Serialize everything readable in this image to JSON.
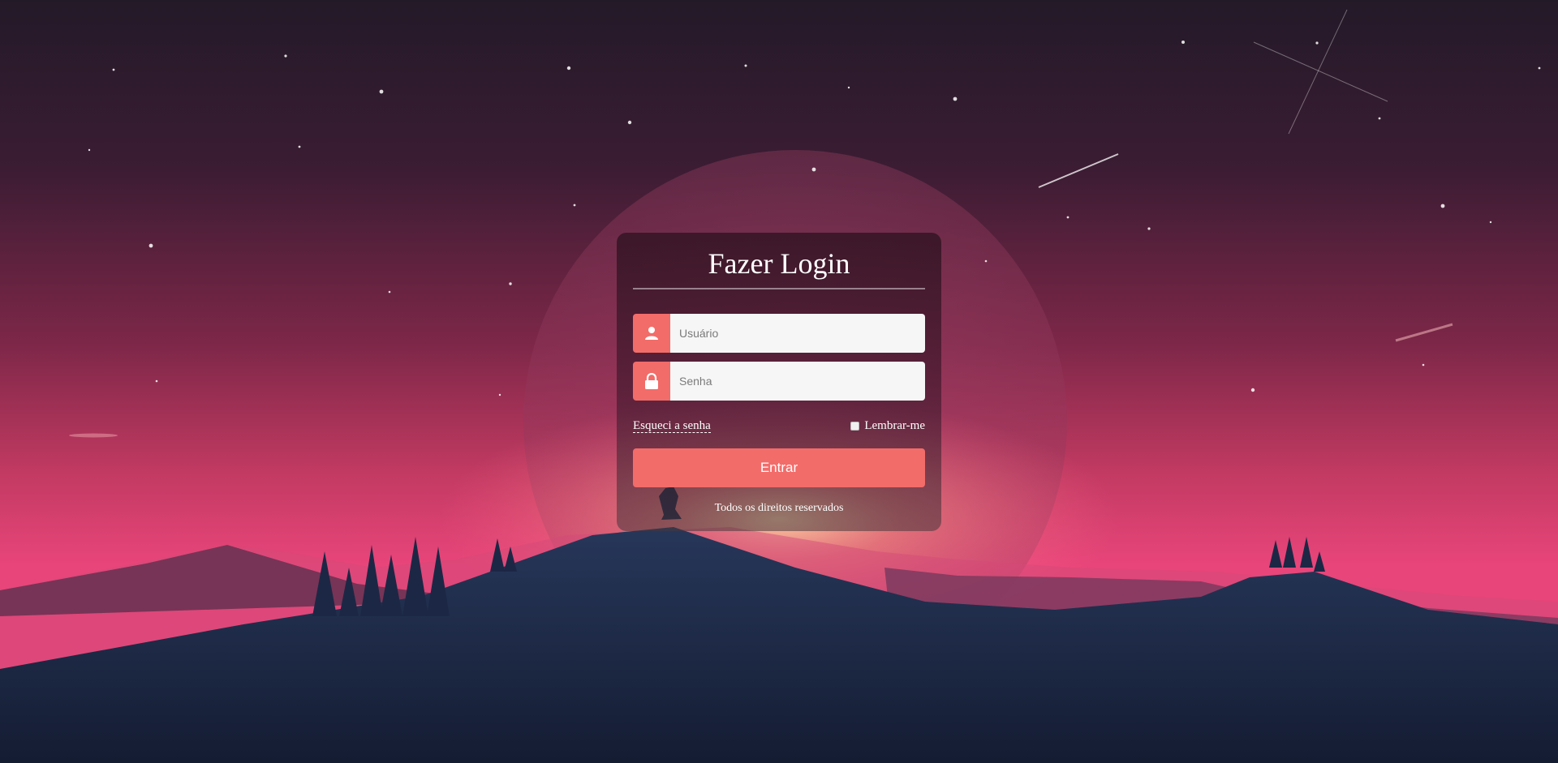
{
  "login": {
    "title": "Fazer Login",
    "username_placeholder": "Usuário",
    "password_placeholder": "Senha",
    "forgot_label": "Esqueci a senha",
    "remember_label": "Lembrar-me",
    "submit_label": "Entrar",
    "footer": "Todos os direitos reservados"
  },
  "icons": {
    "username": "user-icon",
    "password": "lock-icon"
  },
  "colors": {
    "accent": "#f26c6a",
    "sky_top": "#24192a",
    "sky_mid": "#8c2c52",
    "sky_horizon": "#e2406e",
    "mountain": "#1f2a48"
  }
}
